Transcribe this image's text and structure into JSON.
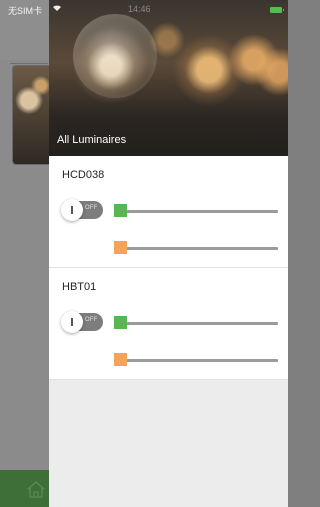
{
  "status_bar": {
    "carrier": "无SIM卡",
    "time": "14:46"
  },
  "drawer": {
    "header_title": "All Luminaires",
    "devices": [
      {
        "name": "HCD038",
        "power_label": "OFF",
        "power_on": false
      },
      {
        "name": "HBT01",
        "power_label": "OFF",
        "power_on": false
      }
    ]
  },
  "colors": {
    "accent_green": "#5ab552",
    "accent_orange": "#f0a55a",
    "tabbar_green": "#3f6f38"
  },
  "icons": {
    "tab_home": "home-icon",
    "status_wifi": "wifi-icon",
    "status_battery": "battery-icon"
  }
}
